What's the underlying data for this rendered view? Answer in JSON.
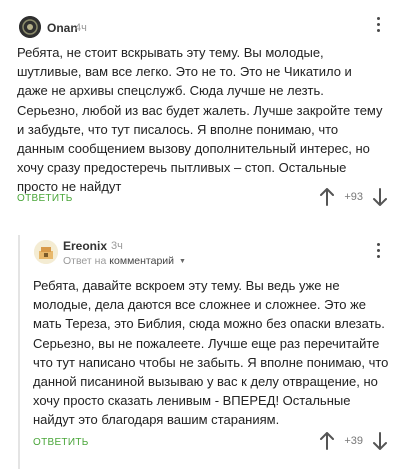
{
  "comments": [
    {
      "username": "Onan",
      "time": "4ч",
      "text": "Ребята, не стоит вскрывать эту тему. Вы молодые, шутливые, вам все легко. Это не то. Это не Чикатило и даже не архивы спецслужб. Сюда лучше не лезть. Серьезно, любой из вас будет жалеть. Лучше закройте тему и забудьте, что тут писалось. Я вполне понимаю, что данным сообщением вызову дополнительный интерес, но хочу сразу предостеречь пытливых – стоп. Остальные просто не найдут",
      "reply_label": "ОТВЕТИТЬ",
      "rating": "+93",
      "icons": {
        "avatar": "avatar-dark",
        "more": "more-vertical-icon",
        "up": "arrow-up-icon",
        "down": "arrow-down-icon"
      }
    },
    {
      "username": "Ereonix",
      "time": "3ч",
      "reply_prefix": "Ответ на",
      "reply_link": "комментарий",
      "text": "Ребята, давайте вскроем эту тему. Вы ведь уже не молодые, дела даются все сложнее и сложнее. Это же мать Тереза, это Библия, сюда можно без опаски влезать. Серьезно, вы не пожалеете. Лучше еще раз перечитайте что тут написано чтобы не забыть. Я вполне понимаю, что данной писаниной вызываю у вас к делу отвращение, но хочу просто сказать ленивым - ВПЕРЕД! Остальные найдут это благодаря вашим стараниям.",
      "reply_label": "ОТВЕТИТЬ",
      "rating": "+39",
      "icons": {
        "avatar": "avatar-light",
        "more": "more-vertical-icon",
        "up": "arrow-up-icon",
        "down": "arrow-down-icon",
        "caret": "caret-down-icon"
      }
    }
  ],
  "colors": {
    "accent": "#4aa63a",
    "muted": "#9a9a9a",
    "text": "#222222"
  }
}
